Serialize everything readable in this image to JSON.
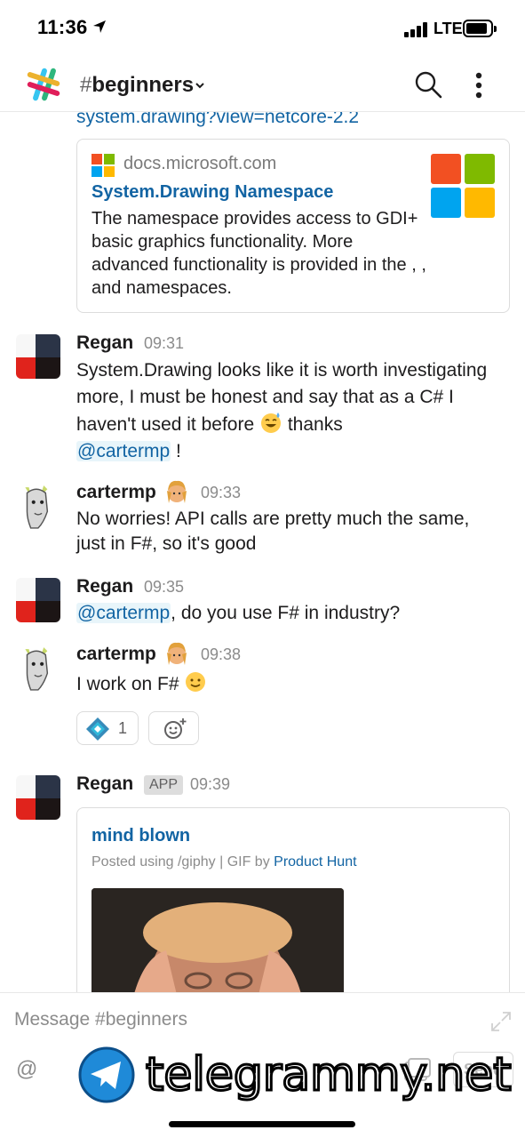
{
  "status_bar": {
    "time": "11:36",
    "network": "LTE"
  },
  "header": {
    "channel_hash": "#",
    "channel_name": "beginners"
  },
  "link_preview_url": "system.drawing?view=netcore-2.2",
  "unfurl": {
    "site": "docs.microsoft.com",
    "title": "System.Drawing Namespace",
    "description": "The namespace provides access to GDI+ basic graphics functionality. More advanced functionality is provided in the , , and namespaces."
  },
  "messages": [
    {
      "author": "Regan",
      "time": "09:31",
      "text_1": "System.Drawing looks like it is worth investigating more, I must be honest and say that as a C# I haven't used it before",
      "text_2": "thanks",
      "mention": "@cartermp",
      "text_3": "!"
    },
    {
      "author": "cartermp",
      "time": "09:33",
      "text": "No worries! API calls are pretty much the same, just in F#, so it's good"
    },
    {
      "author": "Regan",
      "time": "09:35",
      "mention": "@cartermp",
      "text": ", do you use F# in industry?"
    },
    {
      "author": "cartermp",
      "time": "09:38",
      "text": "I work on F#",
      "reaction_count": "1"
    },
    {
      "author": "Regan",
      "badge": "APP",
      "time": "09:39"
    }
  ],
  "giphy": {
    "title": "mind blown",
    "meta_prefix": "Posted using /giphy | GIF by",
    "meta_link": "Product Hunt"
  },
  "composer": {
    "placeholder": "Message #beginners",
    "at_symbol": "@",
    "send_label": "Send"
  },
  "watermark": "telegrammy.net",
  "colors": {
    "link": "#1264a3",
    "mention_bg": "#e8f5fa",
    "text": "#1d1c1d",
    "muted": "#8b8b8b"
  }
}
